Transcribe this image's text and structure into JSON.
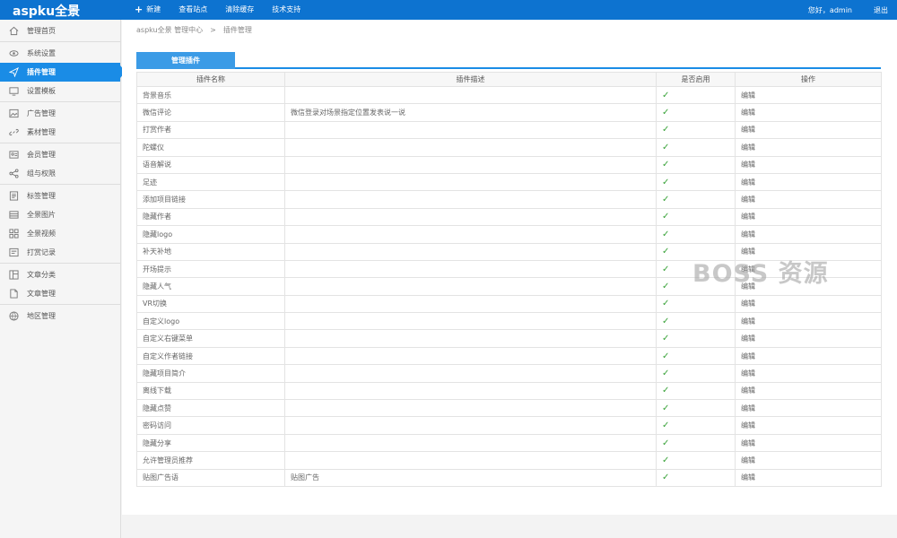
{
  "app": {
    "brand": "aspku全景"
  },
  "topnav": {
    "items": [
      {
        "label": "新建",
        "icon": "plus-icon"
      },
      {
        "label": "查看站点"
      },
      {
        "label": "清除缓存"
      },
      {
        "label": "技术支持"
      }
    ],
    "greeting": "您好，admin",
    "logout": "退出"
  },
  "sidebar": {
    "items": [
      {
        "label": "管理首页",
        "icon": "home-icon"
      },
      {
        "label": "系统设置",
        "icon": "eye-icon"
      },
      {
        "label": "插件管理",
        "icon": "send-icon",
        "active": true
      },
      {
        "label": "设置模板",
        "icon": "monitor-icon"
      },
      {
        "label": "广告管理",
        "icon": "image-icon"
      },
      {
        "label": "素材管理",
        "icon": "link-icon"
      },
      {
        "label": "会员管理",
        "icon": "user-card-icon"
      },
      {
        "label": "组与权限",
        "icon": "share-icon"
      },
      {
        "label": "标签管理",
        "icon": "tag-list-icon"
      },
      {
        "label": "全景图片",
        "icon": "panorama-icon"
      },
      {
        "label": "全景视频",
        "icon": "grid-icon"
      },
      {
        "label": "打赏记录",
        "icon": "record-icon"
      },
      {
        "label": "文章分类",
        "icon": "category-icon"
      },
      {
        "label": "文章管理",
        "icon": "file-icon"
      },
      {
        "label": "地区管理",
        "icon": "map-icon"
      }
    ]
  },
  "breadcrumb": {
    "root": "aspku全景 管理中心",
    "sep": ">",
    "current": "插件管理"
  },
  "tab": {
    "label": "管理插件"
  },
  "table": {
    "headers": [
      "插件名称",
      "插件描述",
      "是否启用",
      "操作"
    ],
    "rows": [
      {
        "name": "背景音乐",
        "desc": ""
      },
      {
        "name": "微信评论",
        "desc": "微信登录对场景指定位置发表说一说"
      },
      {
        "name": "打赏作者",
        "desc": ""
      },
      {
        "name": "陀螺仪",
        "desc": ""
      },
      {
        "name": "语音解说",
        "desc": ""
      },
      {
        "name": "足迹",
        "desc": ""
      },
      {
        "name": "添加项目链接",
        "desc": ""
      },
      {
        "name": "隐藏作者",
        "desc": ""
      },
      {
        "name": "隐藏logo",
        "desc": ""
      },
      {
        "name": "补天补地",
        "desc": ""
      },
      {
        "name": "开场提示",
        "desc": ""
      },
      {
        "name": "隐藏人气",
        "desc": ""
      },
      {
        "name": "VR切换",
        "desc": ""
      },
      {
        "name": "自定义logo",
        "desc": ""
      },
      {
        "name": "自定义右键菜单",
        "desc": ""
      },
      {
        "name": "自定义作者链接",
        "desc": ""
      },
      {
        "name": "隐藏项目简介",
        "desc": ""
      },
      {
        "name": "离线下载",
        "desc": ""
      },
      {
        "name": "隐藏点赞",
        "desc": ""
      },
      {
        "name": "密码访问",
        "desc": ""
      },
      {
        "name": "隐藏分享",
        "desc": ""
      },
      {
        "name": "允许管理员推荐",
        "desc": ""
      },
      {
        "name": "贴图广告语",
        "desc": "贴图广告"
      }
    ],
    "enabled_mark": "✓",
    "action_label": "编辑"
  },
  "watermark": "BOSS 资源",
  "colors": {
    "topbar": "#0d73d0",
    "active": "#1a8ce6",
    "check": "#3aa33a"
  }
}
